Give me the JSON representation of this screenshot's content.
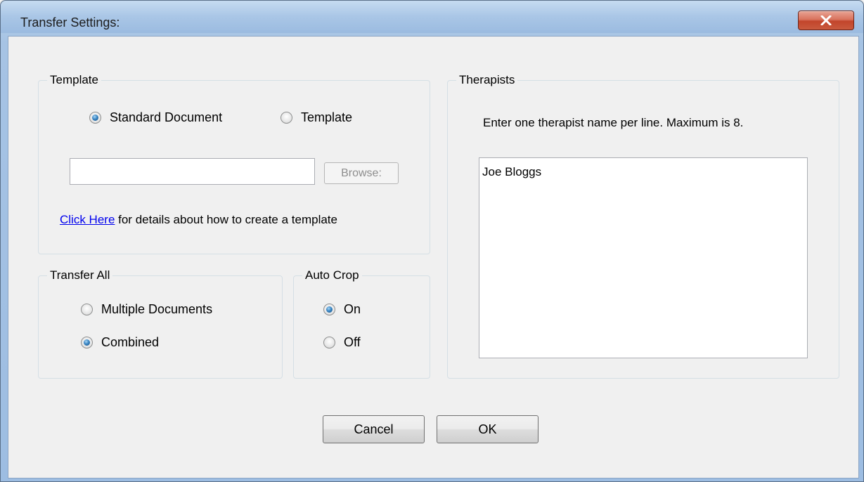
{
  "window": {
    "title": "Transfer Settings:"
  },
  "template_group": {
    "legend": "Template",
    "options": [
      {
        "label": "Standard Document",
        "checked": true
      },
      {
        "label": "Template",
        "checked": false
      }
    ],
    "path_value": "",
    "browse_label": "Browse:",
    "link_text": "Click Here",
    "link_suffix": " for details about how to create a template"
  },
  "transfer_all_group": {
    "legend": "Transfer All",
    "options": [
      {
        "label": "Multiple Documents",
        "checked": false
      },
      {
        "label": "Combined",
        "checked": true
      }
    ]
  },
  "auto_crop_group": {
    "legend": "Auto Crop",
    "options": [
      {
        "label": "On",
        "checked": true
      },
      {
        "label": "Off",
        "checked": false
      }
    ]
  },
  "therapists_group": {
    "legend": "Therapists",
    "hint": "Enter one therapist name per line. Maximum is 8.",
    "names_value": "Joe Bloggs"
  },
  "buttons": {
    "cancel": "Cancel",
    "ok": "OK"
  },
  "colors": {
    "title_bar": "#a9c6e6",
    "close_button": "#c95a3e",
    "radio_selected": "#3a86c4",
    "link": "#0000ee"
  }
}
